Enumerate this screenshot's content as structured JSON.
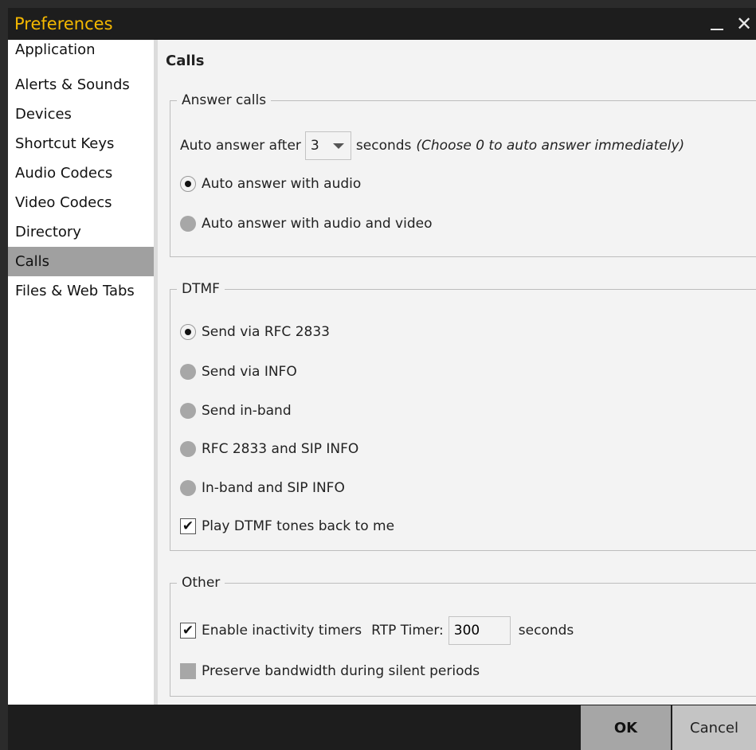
{
  "window": {
    "title": "Preferences",
    "close_glyph": "✕"
  },
  "sidebar": {
    "items": [
      {
        "label": "Application"
      },
      {
        "label": "Alerts & Sounds"
      },
      {
        "label": "Devices"
      },
      {
        "label": "Shortcut Keys"
      },
      {
        "label": "Audio Codecs"
      },
      {
        "label": "Video Codecs"
      },
      {
        "label": "Directory"
      },
      {
        "label": "Calls",
        "selected": true
      },
      {
        "label": "Files & Web Tabs"
      }
    ]
  },
  "page": {
    "title": "Calls"
  },
  "answer_calls": {
    "legend": "Answer calls",
    "auto_answer_prefix": "Auto answer after",
    "auto_answer_value": "3",
    "seconds_label": "seconds",
    "hint": "(Choose 0 to auto answer immediately)",
    "options": [
      {
        "label": "Auto answer with audio",
        "checked": true
      },
      {
        "label": "Auto answer with audio and video",
        "checked": false
      }
    ]
  },
  "dtmf": {
    "legend": "DTMF",
    "options": [
      {
        "label": "Send via RFC 2833",
        "checked": true
      },
      {
        "label": "Send via INFO",
        "checked": false
      },
      {
        "label": "Send in-band",
        "checked": false
      },
      {
        "label": "RFC 2833 and SIP INFO",
        "checked": false
      },
      {
        "label": "In-band and SIP INFO",
        "checked": false
      }
    ],
    "play_tones": {
      "label": "Play DTMF tones back to me",
      "checked": true
    }
  },
  "other": {
    "legend": "Other",
    "inactivity": {
      "label": "Enable inactivity timers",
      "checked": true
    },
    "rtp_timer_label": "RTP Timer:",
    "rtp_timer_value": "300",
    "rtp_seconds_label": "seconds",
    "preserve_bandwidth": {
      "label": "Preserve bandwidth during silent periods",
      "checked": false
    }
  },
  "footer": {
    "ok_label": "OK",
    "cancel_label": "Cancel"
  },
  "colors": {
    "title_text": "#f5b800",
    "title_bar": "#1d1d1d",
    "selected_item": "#a0a0a0"
  },
  "icons": {
    "close": "close-icon",
    "minimize": "minimize-icon",
    "dropdown": "chevron-down-icon",
    "check": "check-icon"
  }
}
